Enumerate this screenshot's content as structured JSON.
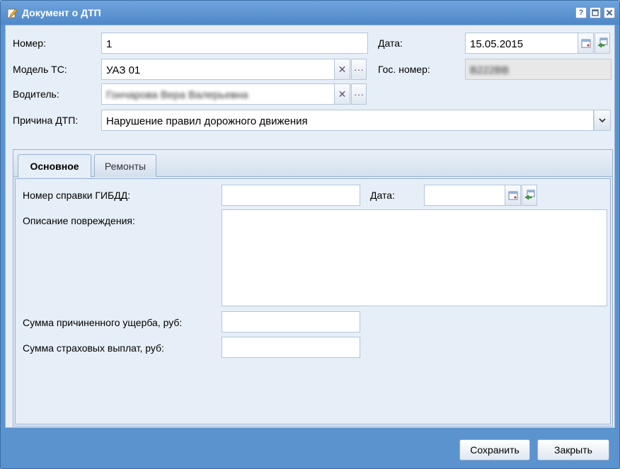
{
  "window": {
    "title": "Документ о ДТП",
    "help_label": "?",
    "icons": {
      "title": "pencil-document-icon",
      "help": "help-icon",
      "maximize": "maximize-icon",
      "close": "close-icon"
    }
  },
  "form": {
    "number_label": "Номер:",
    "number_value": "1",
    "date_label": "Дата:",
    "date_value": "15.05.2015",
    "model_label": "Модель ТС:",
    "model_value": "УАЗ 01",
    "gos_label": "Гос. номер:",
    "gos_value": "В222ВВ",
    "driver_label": "Водитель:",
    "driver_value": "Гончарова Вера Валерьевна",
    "reason_label": "Причина ДТП:",
    "reason_value": "Нарушение правил дорожного движения",
    "clear_glyph": "✕",
    "more_glyph": "···"
  },
  "tabs": [
    {
      "label": "Основное",
      "active": true
    },
    {
      "label": "Ремонты",
      "active": false
    }
  ],
  "main_tab": {
    "gibdd_label": "Номер справки ГИБДД:",
    "gibdd_value": "",
    "date_label": "Дата:",
    "date_value": "",
    "damage_label": "Описание повреждения:",
    "damage_value": "",
    "damage_sum_label": "Сумма причиненного ущерба, руб:",
    "damage_sum_value": "",
    "insurance_label": "Сумма страховых выплат, руб:",
    "insurance_value": ""
  },
  "footer": {
    "save_label": "Сохранить",
    "close_label": "Закрыть"
  }
}
